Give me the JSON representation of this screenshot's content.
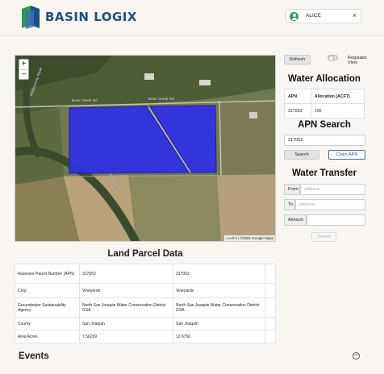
{
  "brand": {
    "name": "BASIN LOGIX"
  },
  "user": {
    "name": "ALICE",
    "close_glyph": "×",
    "icon": "user-icon"
  },
  "map": {
    "zoom_in": "+",
    "zoom_out": "−",
    "attribution_leaflet": "Leaflet",
    "attribution_rest": " | ©2021 Google Maps",
    "roads": [
      "Mokelumne River",
      "Mokelumne River",
      "Bear Creek Rd",
      "Bear Creek Rd",
      "Mokelumne River"
    ],
    "parcel_color": "#2f2fe8"
  },
  "controls": {
    "refresh": "Refresh",
    "toggle_label": "Regulator View"
  },
  "water_allocation": {
    "title": "Water Allocation",
    "columns": [
      "APN",
      "Allocation (ACFT)"
    ],
    "rows": [
      [
        "317053",
        "100"
      ]
    ]
  },
  "apn_search": {
    "title": "APN Search",
    "value": "317053",
    "search_label": "Search",
    "claim_label": "Claim APN"
  },
  "water_transfer": {
    "title": "Water Transfer",
    "from_label": "From",
    "from_placeholder": "address",
    "to_label": "To",
    "to_placeholder": "address",
    "amount_label": "Amount",
    "submit_label": "Submit"
  },
  "land_parcel": {
    "title": "Land Parcel Data",
    "rows": [
      [
        "Assessor Parcel Number (APN)",
        "317053",
        "317053"
      ],
      [
        "Crop",
        "Vineyards",
        "Vineyards"
      ],
      [
        "Groundwater Sustainability Agency",
        "North San Joaquin Water Conservation District GSA",
        "North San Joaquin Water Conservation District GSA"
      ],
      [
        "County",
        "San Joaquin",
        "San Joaquin"
      ],
      [
        "Area Acres",
        "7.56299",
        "12.6756"
      ]
    ]
  },
  "events": {
    "title": "Events",
    "scroll_glyph": "⬏"
  }
}
